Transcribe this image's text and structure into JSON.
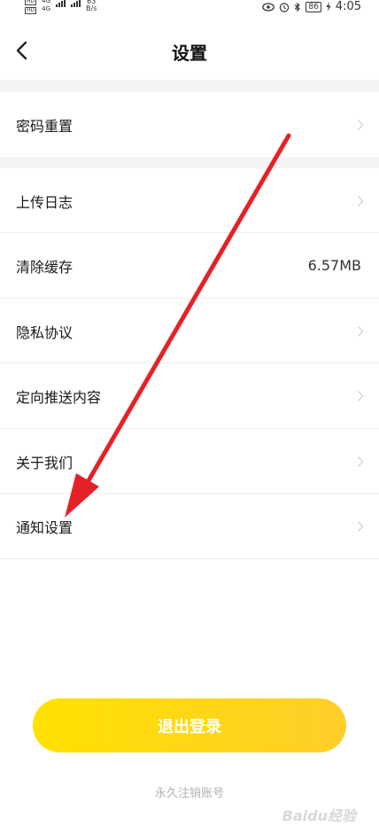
{
  "status_bar": {
    "sim1": "HD",
    "sim2": "HD",
    "net1": "4G",
    "net2": "4G",
    "net_speed_value": "63",
    "net_speed_unit": "B/s",
    "battery": "86",
    "time": "4:05"
  },
  "nav": {
    "title": "设置"
  },
  "settings": {
    "password_reset": "密码重置",
    "items": [
      {
        "label": "上传日志",
        "value": ""
      },
      {
        "label": "清除缓存",
        "value": "6.57MB"
      },
      {
        "label": "隐私协议",
        "value": ""
      },
      {
        "label": "定向推送内容",
        "value": ""
      },
      {
        "label": "关于我们",
        "value": ""
      },
      {
        "label": "通知设置",
        "value": ""
      }
    ]
  },
  "actions": {
    "logout_label": "退出登录",
    "delete_account_label": "永久注销账号"
  },
  "watermark": "Baidu经验",
  "colors": {
    "logout_gradient_start": "#ffe100",
    "logout_gradient_end": "#ffce2a",
    "annotation_arrow": "#e52128",
    "section_gap": "#f4f4f4"
  }
}
